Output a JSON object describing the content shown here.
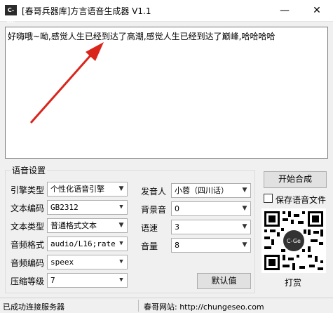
{
  "window": {
    "title": "[春哥兵器库]方言语音生成器 V1.1",
    "icon_text": "C-Ge",
    "minimize_glyph": "—",
    "close_glyph": "✕"
  },
  "editor": {
    "text": "好嗨哦~呦,感觉人生已经到达了高潮,感觉人生已经到达了巅峰,哈哈哈哈"
  },
  "settings": {
    "group_title": "语音设置",
    "engine": {
      "label": "引擎类型",
      "value": "个性化语音引擎"
    },
    "encoding": {
      "label": "文本编码",
      "value": "GB2312"
    },
    "text_type": {
      "label": "文本类型",
      "value": "普通格式文本"
    },
    "audio_format": {
      "label": "音频格式",
      "value": "audio/L16;rate="
    },
    "audio_codec": {
      "label": "音频编码",
      "value": "speex"
    },
    "compression": {
      "label": "压缩等级",
      "value": "7"
    },
    "speaker": {
      "label": "发音人",
      "value": "小蓉（四川话）"
    },
    "bg_sound": {
      "label": "背景音",
      "value": "0"
    },
    "speed": {
      "label": "语速",
      "value": "3"
    },
    "volume": {
      "label": "音量",
      "value": "8"
    },
    "default_button": "默认值"
  },
  "side": {
    "start_button": "开始合成",
    "save_checkbox": "保存语音文件",
    "qr_logo": "C-Ge",
    "donate_label": "打赏"
  },
  "status": {
    "left": "已成功连接服务器",
    "right": "春哥网站: http://chungeseo.com"
  },
  "colors": {
    "arrow": "#d9251c",
    "window_bg": "#f0f0f0"
  }
}
